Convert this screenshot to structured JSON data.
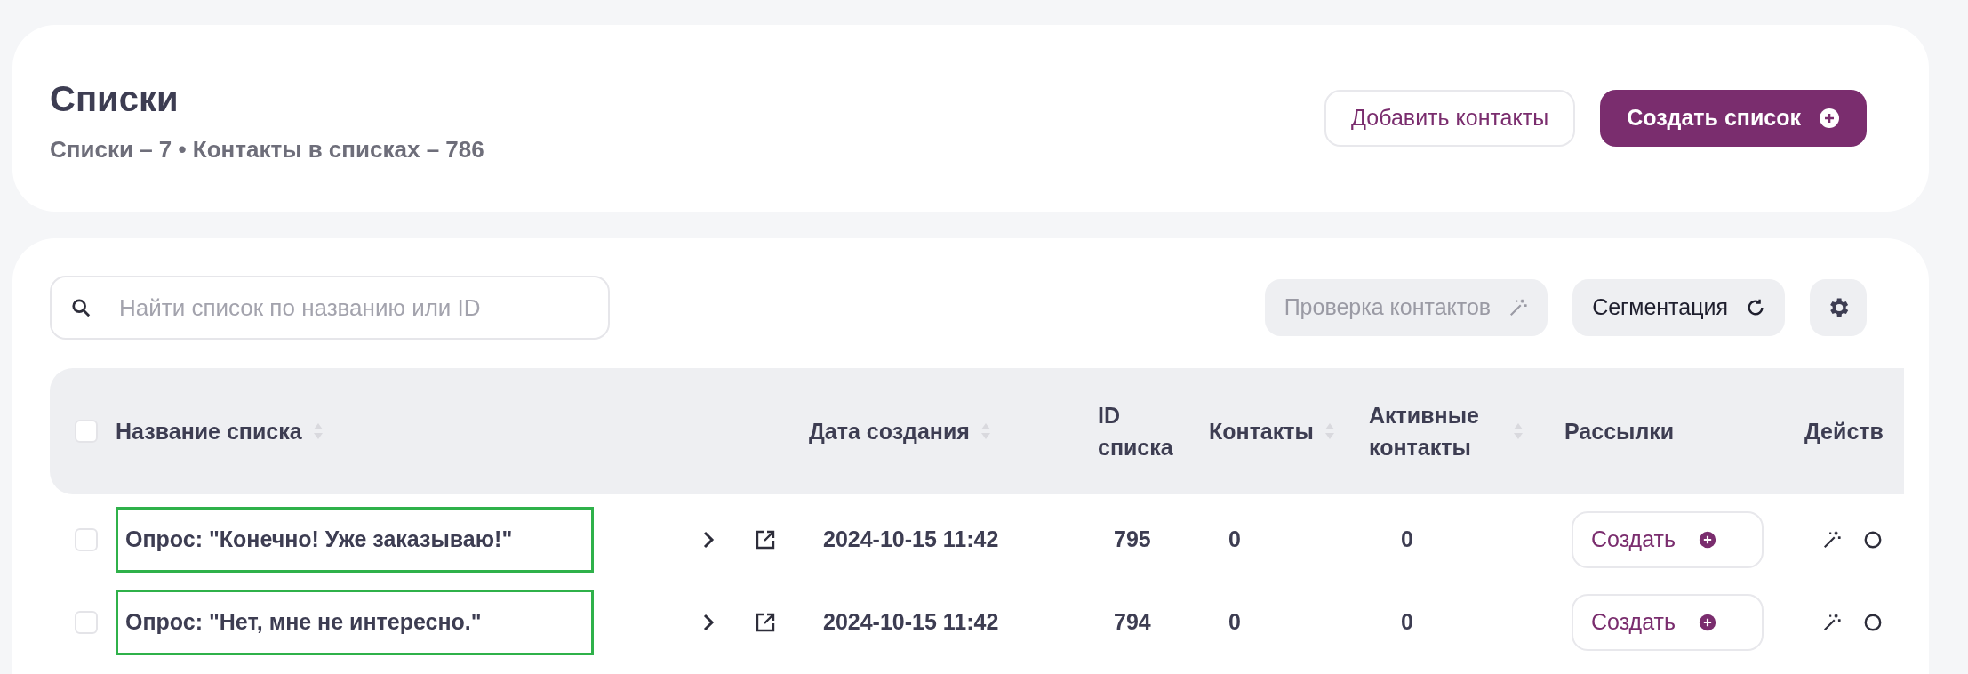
{
  "header": {
    "title": "Списки",
    "subtitle": "Списки – 7 • Контакты в списках – 786",
    "buttons": [
      {
        "label": "Добавить контакты",
        "kind": "outline"
      },
      {
        "label": "Создать список",
        "kind": "primary"
      }
    ]
  },
  "toolbar": {
    "search": {
      "placeholder": "Найти список по названию или ID"
    },
    "buttons": [
      {
        "label": "Проверка контактов",
        "kind": "wand",
        "disabled": true
      },
      {
        "label": "Сегментация",
        "kind": "refresh",
        "disabled": false
      }
    ]
  },
  "table": {
    "select_all": {
      "checked": false
    },
    "columns": [
      {
        "label": "Название списка",
        "sortable": true
      },
      {
        "label": "Дата создания",
        "sortable": true
      },
      {
        "label": "ID списка",
        "sortable": false
      },
      {
        "label": "Контакты",
        "sortable": true
      },
      {
        "label": "Активные контакты",
        "sortable": true
      },
      {
        "label": "Рассылки",
        "sortable": false
      },
      {
        "label": "Действ",
        "sortable": false
      }
    ],
    "rows": [
      {
        "checked": false,
        "highlighted": true,
        "name": "Опрос: \"Конечно! Уже заказываю!\"",
        "created": "2024-10-15 11:42",
        "id": "795",
        "contacts": "0",
        "active_contacts": "0",
        "mailing_button": "Создать"
      },
      {
        "checked": false,
        "highlighted": true,
        "name": "Опрос: \"Нет, мне не интересно.\"",
        "created": "2024-10-15 11:42",
        "id": "794",
        "contacts": "0",
        "active_contacts": "0",
        "mailing_button": "Создать"
      }
    ]
  }
}
